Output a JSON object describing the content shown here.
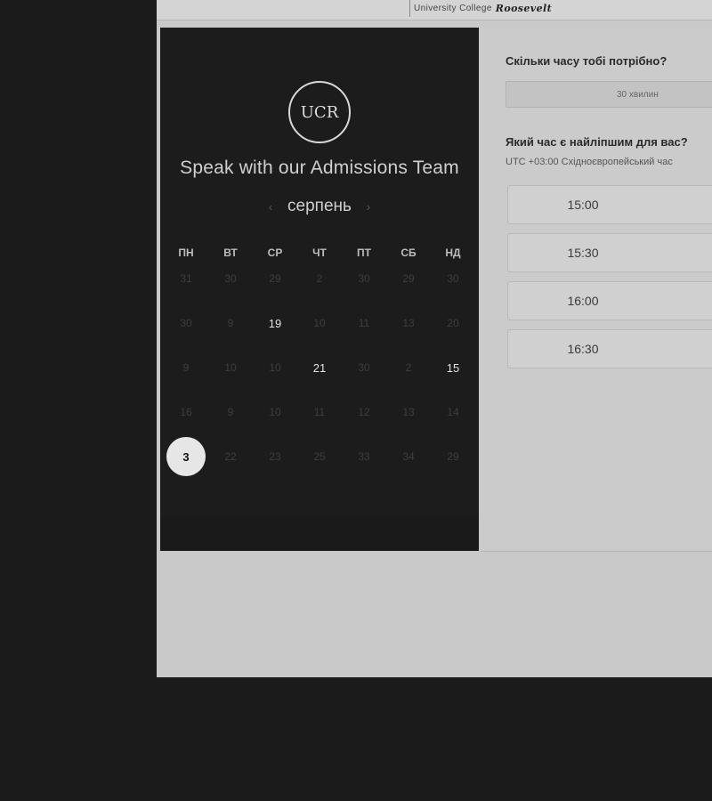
{
  "header": {
    "brand_sub": "University College",
    "brand_main": "Roosevelt"
  },
  "left": {
    "logo_text": "UCR",
    "title": "Speak with our Admissions Team",
    "month": "серпень",
    "prev_arrow": "‹",
    "next_arrow": "›",
    "weekdays": [
      "ПН",
      "ВТ",
      "СР",
      "ЧТ",
      "ПТ",
      "СБ",
      "НД"
    ],
    "days": [
      {
        "label": "31",
        "available": false,
        "selected": false
      },
      {
        "label": "30",
        "available": false,
        "selected": false
      },
      {
        "label": "29",
        "available": false,
        "selected": false
      },
      {
        "label": "2",
        "available": false,
        "selected": false
      },
      {
        "label": "30",
        "available": false,
        "selected": false
      },
      {
        "label": "29",
        "available": false,
        "selected": false
      },
      {
        "label": "30",
        "available": false,
        "selected": false
      },
      {
        "label": "30",
        "available": false,
        "selected": false
      },
      {
        "label": "9",
        "available": false,
        "selected": false
      },
      {
        "label": "19",
        "available": true,
        "selected": false
      },
      {
        "label": "10",
        "available": false,
        "selected": false
      },
      {
        "label": "11",
        "available": false,
        "selected": false
      },
      {
        "label": "13",
        "available": false,
        "selected": false
      },
      {
        "label": "20",
        "available": false,
        "selected": false
      },
      {
        "label": "9",
        "available": false,
        "selected": false
      },
      {
        "label": "10",
        "available": false,
        "selected": false
      },
      {
        "label": "10",
        "available": false,
        "selected": false
      },
      {
        "label": "21",
        "available": true,
        "selected": false
      },
      {
        "label": "30",
        "available": false,
        "selected": false
      },
      {
        "label": "2",
        "available": false,
        "selected": false
      },
      {
        "label": "15",
        "available": true,
        "selected": false
      },
      {
        "label": "16",
        "available": false,
        "selected": false
      },
      {
        "label": "9",
        "available": false,
        "selected": false
      },
      {
        "label": "10",
        "available": false,
        "selected": false
      },
      {
        "label": "11",
        "available": false,
        "selected": false
      },
      {
        "label": "12",
        "available": false,
        "selected": false
      },
      {
        "label": "13",
        "available": false,
        "selected": false
      },
      {
        "label": "14",
        "available": false,
        "selected": false
      },
      {
        "label": "3",
        "available": true,
        "selected": true
      },
      {
        "label": "22",
        "available": false,
        "selected": false
      },
      {
        "label": "23",
        "available": false,
        "selected": false
      },
      {
        "label": "25",
        "available": false,
        "selected": false
      },
      {
        "label": "33",
        "available": false,
        "selected": false
      },
      {
        "label": "34",
        "available": false,
        "selected": false
      },
      {
        "label": "29",
        "available": false,
        "selected": false
      }
    ]
  },
  "right": {
    "duration_question": "Скільки часу тобі потрібно?",
    "duration_value": "30 хвилин",
    "time_question": "Який час є найліпшим для вас?",
    "timezone": "UTC +03:00 Східноєвропейський час",
    "slots": [
      "15:00",
      "15:30",
      "16:00",
      "16:30"
    ]
  }
}
